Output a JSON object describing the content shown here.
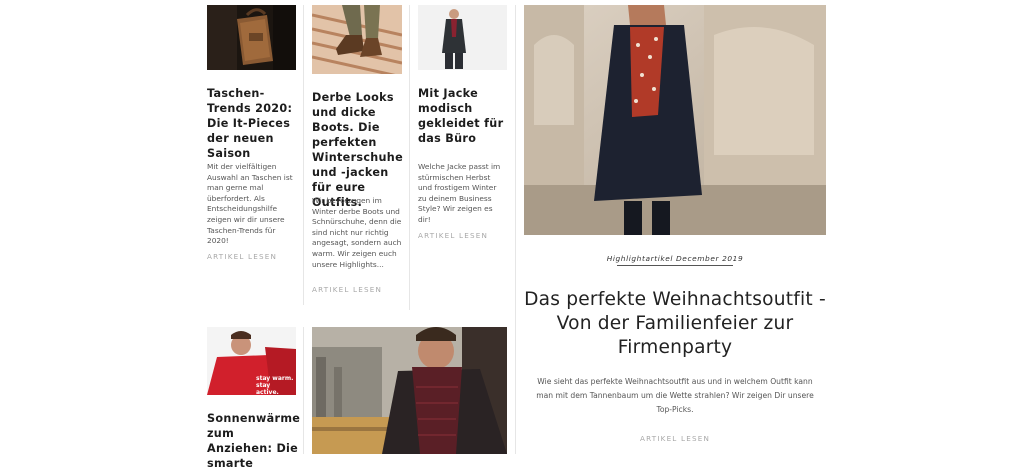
{
  "cards": [
    {
      "title": "Taschen-Trends 2020: Die It-Pieces der neuen Saison",
      "text": "Mit der vielfältigen Auswahl an Taschen ist man gerne mal überfordert. Als Entscheidungshilfe zeigen wir dir unsere Taschen-Trends für 2020!",
      "link": "ARTIKEL LESEN",
      "image_icon": "leather-bag-photo"
    },
    {
      "title": "Derbe Looks und dicke Boots. Die perfekten Winterschuhe und -jacken für eure Outfits.",
      "text": "Wir bevorzugen im Winter derbe Boots und Schnürschuhe, denn die sind nicht nur richtig angesagt, sondern auch warm. Wir zeigen euch unsere Highlights...",
      "link": "ARTIKEL LESEN",
      "image_icon": "boots-on-bench-photo"
    },
    {
      "title": "Mit Jacke modisch gekleidet für das Büro",
      "text": "Welche Jacke passt im stürmischen Herbst und frostigem Winter zu deinem Business Style? Wir zeigen es dir!",
      "link": "ARTIKEL LESEN",
      "image_icon": "man-in-coat-photo"
    },
    {
      "title": "Sonnenwärme zum Anziehen: Die smarte",
      "image_icon": "red-jacket-photo",
      "image_caption": "stay warm.\nstay active."
    },
    {
      "image_icon": "man-with-scarf-photo"
    }
  ],
  "highlight": {
    "label": "Highlightartikel December 2019",
    "title": "Das perfekte Weihnachtsoutfit - Von der Familienfeier zur Firmenparty",
    "text": "Wie sieht das perfekte Weihnachtsoutfit aus und in welchem Outfit kann man mit dem Tannenbaum um die Wette strahlen? Wir zeigen Dir unsere Top-Picks.",
    "link": "ARTIKEL LESEN",
    "image_icon": "woman-in-winter-coat-photo"
  }
}
